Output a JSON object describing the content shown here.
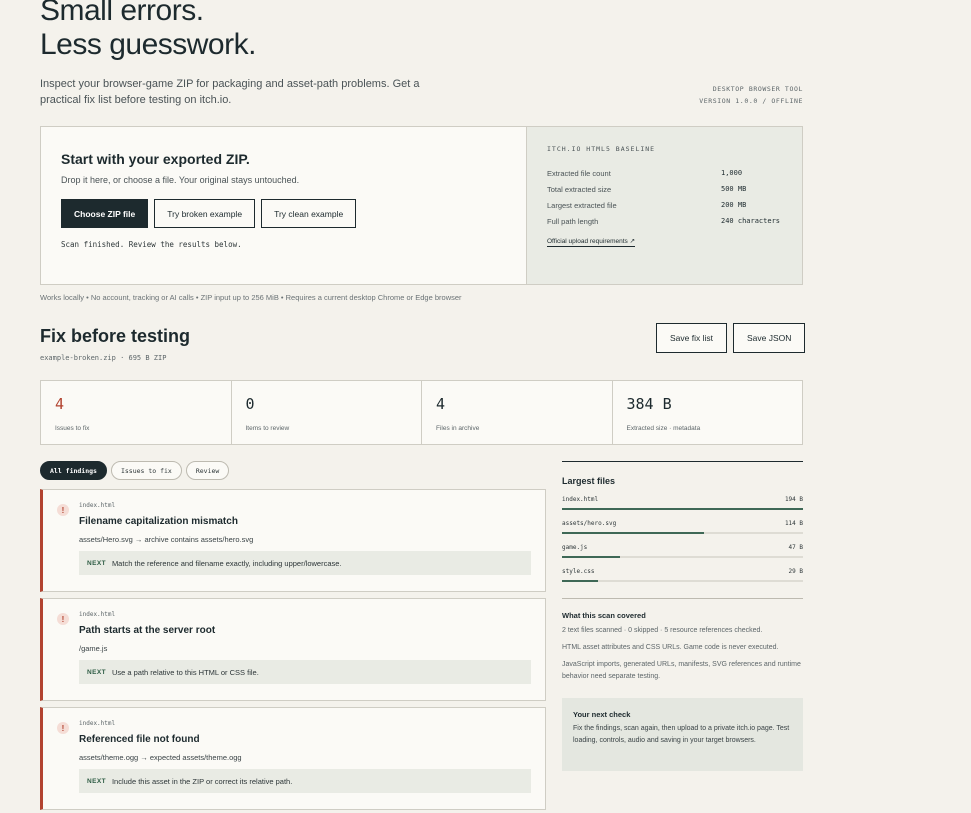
{
  "hero": {
    "title_line1": "Small errors.",
    "title_line2": "Less guesswork.",
    "subtitle": "Inspect your browser-game ZIP for packaging and asset-path problems. Get a practical fix list before testing on itch.io.",
    "meta_line1": "DESKTOP BROWSER TOOL",
    "meta_line2": "VERSION 1.0.0 / OFFLINE"
  },
  "upload": {
    "title": "Start with your exported ZIP.",
    "description": "Drop it here, or choose a file. Your original stays untouched.",
    "choose_label": "Choose ZIP file",
    "broken_label": "Try broken example",
    "clean_label": "Try clean example",
    "status": "Scan finished. Review the results below."
  },
  "baseline": {
    "title": "ITCH.IO HTML5 BASELINE",
    "rows": [
      {
        "key": "Extracted file count",
        "value": "1,000"
      },
      {
        "key": "Total extracted size",
        "value": "500 MB"
      },
      {
        "key": "Largest extracted file",
        "value": "200 MB"
      },
      {
        "key": "Full path length",
        "value": "240 characters"
      }
    ],
    "link": "Official upload requirements ↗"
  },
  "footnote": "Works locally • No account, tracking or AI calls • ZIP input up to 256 MiB • Requires a current desktop Chrome or Edge browser",
  "results": {
    "title": "Fix before testing",
    "file": "example-broken.zip · 695 B ZIP",
    "save_fix": "Save fix list",
    "save_json": "Save JSON"
  },
  "stats": [
    {
      "value": "4",
      "label": "Issues to fix"
    },
    {
      "value": "0",
      "label": "Items to review"
    },
    {
      "value": "4",
      "label": "Files in archive"
    },
    {
      "value": "384 B",
      "label": "Extracted size · metadata"
    }
  ],
  "tabs": [
    "All findings",
    "Issues to fix",
    "Review"
  ],
  "findings": [
    {
      "file": "index.html",
      "title": "Filename capitalization mismatch",
      "detail": "assets/Hero.svg → archive contains assets/hero.svg",
      "next_tag": "NEXT",
      "next": "Match the reference and filename exactly, including upper/lowercase."
    },
    {
      "file": "index.html",
      "title": "Path starts at the server root",
      "detail": "/game.js",
      "next_tag": "NEXT",
      "next": "Use a path relative to this HTML or CSS file."
    },
    {
      "file": "index.html",
      "title": "Referenced file not found",
      "detail": "assets/theme.ogg → expected assets/theme.ogg",
      "next_tag": "NEXT",
      "next": "Include this asset in the ZIP or correct its relative path."
    }
  ],
  "largest_files": {
    "title": "Largest files",
    "items": [
      {
        "name": "index.html",
        "size": "194 B",
        "fraction": 1.0
      },
      {
        "name": "assets/hero.svg",
        "size": "114 B",
        "fraction": 0.588
      },
      {
        "name": "game.js",
        "size": "47 B",
        "fraction": 0.242
      },
      {
        "name": "style.css",
        "size": "29 B",
        "fraction": 0.149
      }
    ]
  },
  "coverage": {
    "title": "What this scan covered",
    "p1": "2 text files scanned · 0 skipped · 5 resource references checked.",
    "p2": "HTML asset attributes and CSS URLs. Game code is never executed.",
    "p3": "JavaScript imports, generated URLs, manifests, SVG references and runtime behavior need separate testing."
  },
  "next_check": {
    "title": "Your next check",
    "body": "Fix the findings, scan again, then upload to a private itch.io page. Test loading, controls, audio and saving in your target browsers."
  },
  "colors": {
    "accent_dark": "#1d2a2e",
    "alert": "#b24330",
    "bar": "#3e6856"
  }
}
